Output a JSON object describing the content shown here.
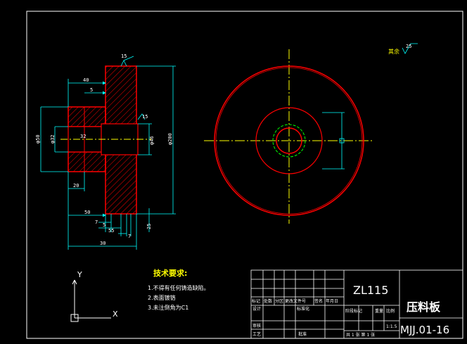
{
  "colors": {
    "background": "#000000",
    "frame": "#ffffff",
    "outline": "#ff0000",
    "centerline": "#ffff00",
    "dimension": "#00ffff",
    "thread": "#00ff00",
    "notes_text": "#ffffff"
  },
  "front_view": {
    "roughness_top": "15",
    "dims": {
      "d40": "40",
      "d5": "5",
      "d15": "15",
      "phi50": "φ50",
      "phi32": "φ32",
      "m32": "32",
      "phi46": "φ46",
      "phi200": "φ200",
      "d20": "20",
      "d50": "50",
      "d7a": "7",
      "d5b": "5",
      "d55": "55",
      "d7b": "7",
      "d25": "25",
      "d30": "30"
    }
  },
  "side_view": {
    "roughness_label": "其余",
    "roughness_value": "25"
  },
  "notes": {
    "title": "技术要求:",
    "items": [
      "1.不得有任何铸造缺陷。",
      "2.表面镀铬",
      "3.未注倒角为C1"
    ]
  },
  "axes": {
    "y_label": "Y",
    "x_label": "X"
  },
  "title_block": {
    "product_code": "ZL115",
    "part_name": "压料板",
    "drawing_no": "MJJ.01-16",
    "row_labels": [
      "标记",
      "处数",
      "分区",
      "更改文件号",
      "签名",
      "年月日"
    ],
    "design": "设计",
    "standardize": "标准化",
    "review": "审核",
    "process": "工艺",
    "approve": "批准",
    "stage_mark": "阶段标记",
    "weight": "重量",
    "scale": "比例",
    "scale_value": "1:1.5",
    "sheets": "共 1 张  第 1 张"
  }
}
